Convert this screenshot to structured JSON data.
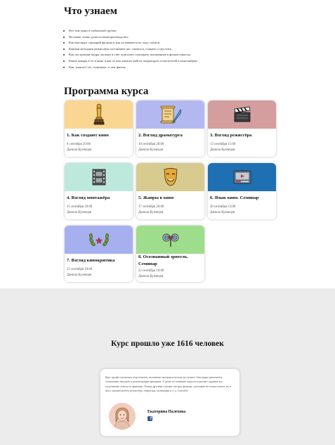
{
  "learn": {
    "heading": "Что узнаем",
    "items": [
      "Кто чем занят в съёмочной группе;",
      "На какие этапы делится кинопроизводство;",
      "Как выглядит сценарий фильма и как он меняется по ходу съёмок;",
      "Какими методами режиссёры заставляют нас смеяться, плакать и грустить;",
      "Как построение кадра, музыка и свет помогают считывать заложенные в фильм смыслы;",
      "Какие жанры есть в кино и как от них зависит работа операторов, осветителей и монтажёров;",
      "Как, зная всё это, понимать, о чем фильм."
    ]
  },
  "program": {
    "heading": "Программа курса",
    "cards": [
      {
        "title": "1. Как создают кино",
        "date": "8 сентября 20:00",
        "author": "Данила Кузнецов",
        "color": "#f9d793",
        "icon": "oscar-statuette-icon"
      },
      {
        "title": "2. Взгляд драматурга",
        "date": "10 сентября 20:00",
        "author": "Данила Кузнецов",
        "color": "#b3b9f0",
        "icon": "scroll-and-quill-icon"
      },
      {
        "title": "3. Взгляд режиссёра",
        "date": "13 сентября 15:00",
        "author": "Данила Кузнецов",
        "color": "#d49e9f",
        "icon": "clapperboard-icon"
      },
      {
        "title": "4. Взгляд монтажёра",
        "date": "15 сентября 20:00",
        "author": "Данила Кузнецов",
        "color": "#bde9dc",
        "icon": "film-strip-icon"
      },
      {
        "title": "5. Жанры в кино",
        "date": "17 сентября 20:00",
        "author": "Данила Кузнецов",
        "color": "#d7cb90",
        "icon": "theater-mask-icon"
      },
      {
        "title": "6. Язык кино. Семинар",
        "date": "20 сентября 13:00",
        "author": "Данила Кузнецов",
        "color": "#1f6fb3",
        "icon": "video-player-icon"
      },
      {
        "title": "7. Взгляд кинокритика",
        "date": "23 сентября 19:00",
        "author": "Данила Кузнецов",
        "color": "#a6b0ef",
        "icon": "laurel-wreath-icon"
      },
      {
        "title": "8. Осознанный зритель. Семинар",
        "date": "22 сентября 19:00",
        "author": "Данила Кузнецов",
        "color": "#9ddd8c",
        "icon": "opera-glasses-icon"
      }
    ]
  },
  "stats": {
    "heading": "Курс прошло уже 1616 человек"
  },
  "review": {
    "text": "Курс профессионально подготовлен, изложение материала весьма доступное, благодаря грамотному оглашению лекторов и демонстрации примеров. А далее не понимаю задался позволяет задавать все получаемые ответы за практики. Теперь другими глазами смотрю фильмы, учитываю не только сюжет, но и могу оценить работу режиссёра, оператора, монтажёра и т. д. Спасибо!",
    "name": "Екатерина Палехова",
    "social_icon": "facebook-icon"
  }
}
